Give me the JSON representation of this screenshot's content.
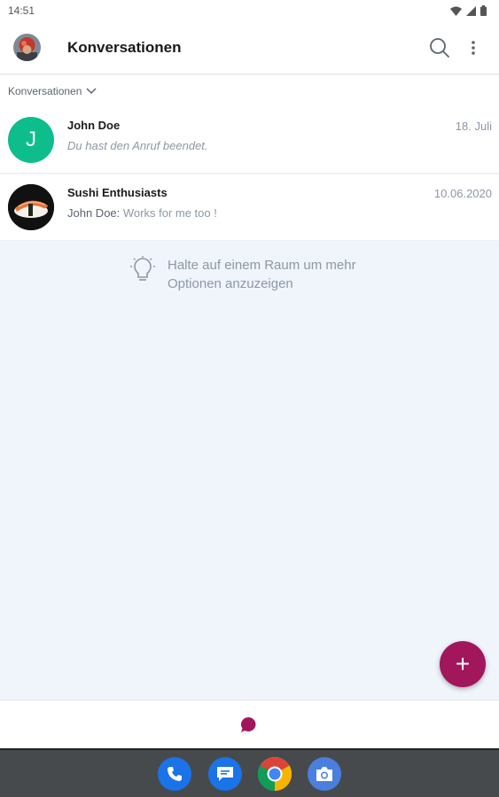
{
  "status_bar": {
    "time": "14:51"
  },
  "app_bar": {
    "title": "Konversationen"
  },
  "section": {
    "label": "Konversationen"
  },
  "rooms": [
    {
      "name": "John Doe",
      "avatar_letter": "J",
      "date": "18. Juli",
      "last_message": "Du hast den Anruf beendet.",
      "sender": ""
    },
    {
      "name": "Sushi Enthusiasts",
      "date": "10.06.2020",
      "sender": "John Doe:",
      "last_message": "Works for me too !"
    }
  ],
  "hint": {
    "text": "Halte auf einem Raum um mehr Optionen anzuzeigen"
  },
  "fab": {
    "label": "+"
  },
  "colors": {
    "accent": "#a2165c",
    "avatar_green": "#0dbd8b",
    "background": "#f0f5fc"
  },
  "icons": [
    "search-icon",
    "more-vert-icon",
    "chevron-down-icon",
    "lightbulb-icon",
    "chat-bubble-icon",
    "phone-icon",
    "messages-icon",
    "chrome-icon",
    "camera-icon"
  ]
}
